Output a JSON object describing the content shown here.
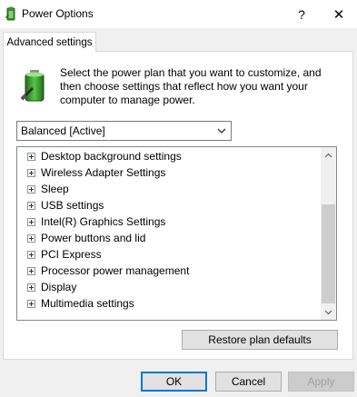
{
  "window": {
    "title": "Power Options",
    "help_label": "?",
    "close_label": "✕"
  },
  "tabs": [
    {
      "label": "Advanced settings",
      "active": true
    }
  ],
  "description": "Select the power plan that you want to customize, and then choose settings that reflect how you want your computer to manage power.",
  "plan_select": {
    "selected": "Balanced [Active]"
  },
  "settings_tree": [
    "Desktop background settings",
    "Wireless Adapter Settings",
    "Sleep",
    "USB settings",
    "Intel(R) Graphics Settings",
    "Power buttons and lid",
    "PCI Express",
    "Processor power management",
    "Display",
    "Multimedia settings"
  ],
  "buttons": {
    "restore": "Restore plan defaults",
    "ok": "OK",
    "cancel": "Cancel",
    "apply": "Apply"
  },
  "colors": {
    "accent": "#0078d7",
    "window_bg": "#f0f0f0",
    "panel_bg": "#ffffff"
  },
  "icons": {
    "app": "power-options-icon",
    "header": "battery-plug-icon",
    "dropdown": "chevron-down-icon",
    "expander": "plus-expander-icon",
    "scroll_up": "chevron-up-icon",
    "scroll_down": "chevron-down-icon"
  }
}
